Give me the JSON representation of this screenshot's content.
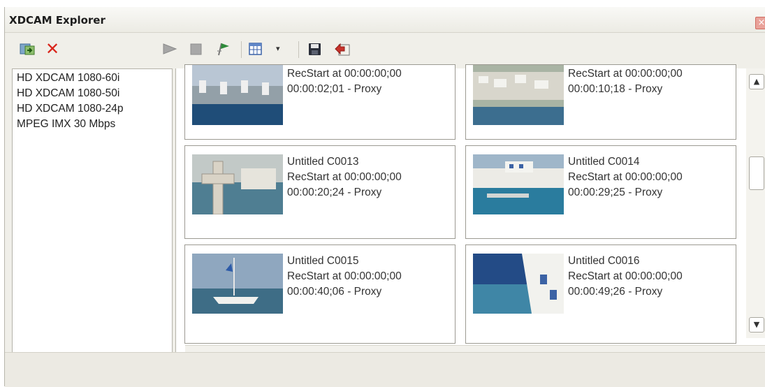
{
  "window": {
    "title": "XDCAM Explorer",
    "close_glyph": "×"
  },
  "toolbar": {
    "icons": [
      "import-clips-icon",
      "delete-icon",
      "play-icon",
      "stop-icon",
      "flag-icon",
      "view-mode-icon",
      "save-icon",
      "export-icon"
    ],
    "delete_glyph": "✕",
    "view_dropdown_glyph": "▾"
  },
  "presets": [
    "HD XDCAM 1080-60i",
    "HD XDCAM 1080-50i",
    "HD XDCAM 1080-24p",
    "MPEG IMX 30 Mbps"
  ],
  "clips": [
    {
      "name": "",
      "recstart": "RecStart at 00:00:00;00",
      "duration": "00:00:02;01 - Proxy"
    },
    {
      "name": "",
      "recstart": "RecStart at 00:00:00;00",
      "duration": "00:00:10;18 - Proxy"
    },
    {
      "name": "Untitled C0013",
      "recstart": "RecStart at 00:00:00;00",
      "duration": "00:00:20;24 - Proxy"
    },
    {
      "name": "Untitled C0014",
      "recstart": "RecStart at 00:00:00;00",
      "duration": "00:00:29;25 - Proxy"
    },
    {
      "name": "Untitled C0015",
      "recstart": "RecStart at 00:00:00;00",
      "duration": "00:00:40;06 - Proxy"
    },
    {
      "name": "Untitled C0016",
      "recstart": "RecStart at 00:00:00;00",
      "duration": "00:00:49;26 - Proxy"
    }
  ],
  "scrollbar": {
    "up_glyph": "▲",
    "down_glyph": "▼"
  },
  "colors": {
    "accent_red": "#d9261c",
    "play_grey": "#9a9a9a",
    "flag_green": "#2e8b3a"
  }
}
